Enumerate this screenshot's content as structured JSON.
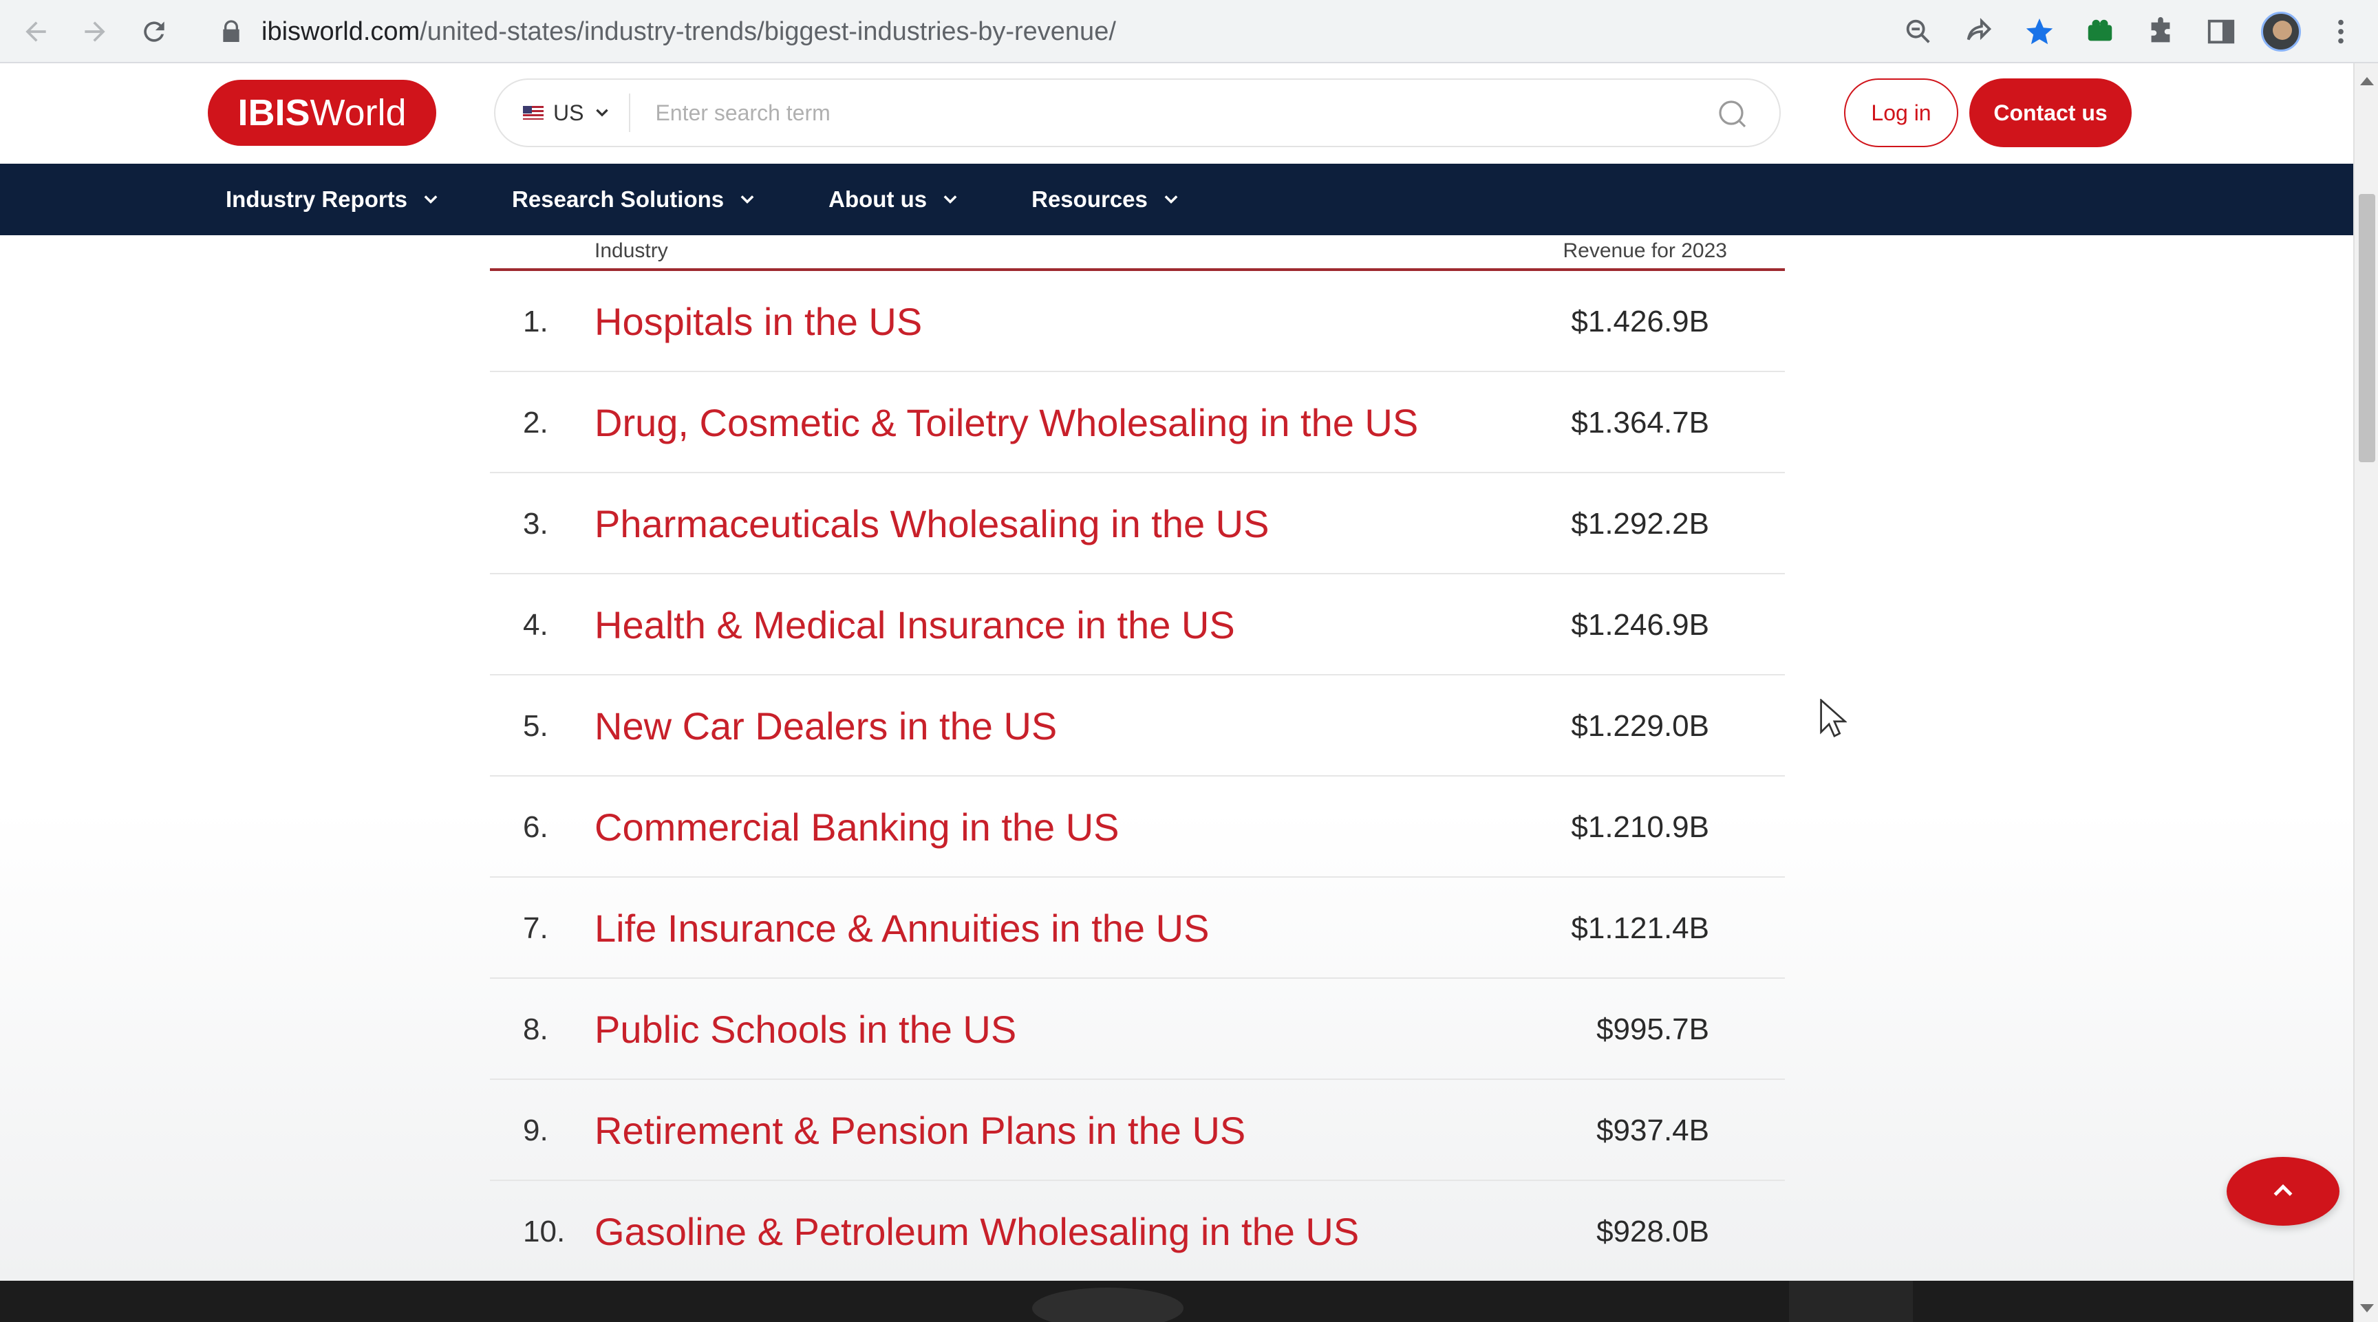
{
  "browser": {
    "url_host": "ibisworld.com",
    "url_path": "/united-states/industry-trends/biggest-industries-by-revenue/"
  },
  "header": {
    "logo_bold": "IBIS",
    "logo_regular": "World",
    "country": "US",
    "search_placeholder": "Enter search term",
    "login_label": "Log in",
    "contact_label": "Contact us"
  },
  "nav": {
    "items": [
      {
        "label": "Industry Reports"
      },
      {
        "label": "Research Solutions"
      },
      {
        "label": "About us"
      },
      {
        "label": "Resources"
      }
    ]
  },
  "table": {
    "col_industry": "Industry",
    "col_revenue": "Revenue for 2023",
    "rows": [
      {
        "rank": "1.",
        "name": "Hospitals in the US",
        "revenue": "$1.426.9B"
      },
      {
        "rank": "2.",
        "name": "Drug, Cosmetic & Toiletry Wholesaling in the US",
        "revenue": "$1.364.7B"
      },
      {
        "rank": "3.",
        "name": "Pharmaceuticals Wholesaling in the US",
        "revenue": "$1.292.2B"
      },
      {
        "rank": "4.",
        "name": "Health & Medical Insurance in the US",
        "revenue": "$1.246.9B"
      },
      {
        "rank": "5.",
        "name": "New Car Dealers in the US",
        "revenue": "$1.229.0B"
      },
      {
        "rank": "6.",
        "name": "Commercial Banking in the US",
        "revenue": "$1.210.9B"
      },
      {
        "rank": "7.",
        "name": "Life Insurance & Annuities in the US",
        "revenue": "$1.121.4B"
      },
      {
        "rank": "8.",
        "name": "Public Schools in the US",
        "revenue": "$995.7B"
      },
      {
        "rank": "9.",
        "name": "Retirement & Pension Plans in the US",
        "revenue": "$937.4B"
      },
      {
        "rank": "10.",
        "name": "Gasoline & Petroleum Wholesaling in the US",
        "revenue": "$928.0B"
      }
    ]
  },
  "colors": {
    "brand_red": "#d0141b",
    "link_red": "#c8202a",
    "nav_navy": "#0d1f3c"
  }
}
